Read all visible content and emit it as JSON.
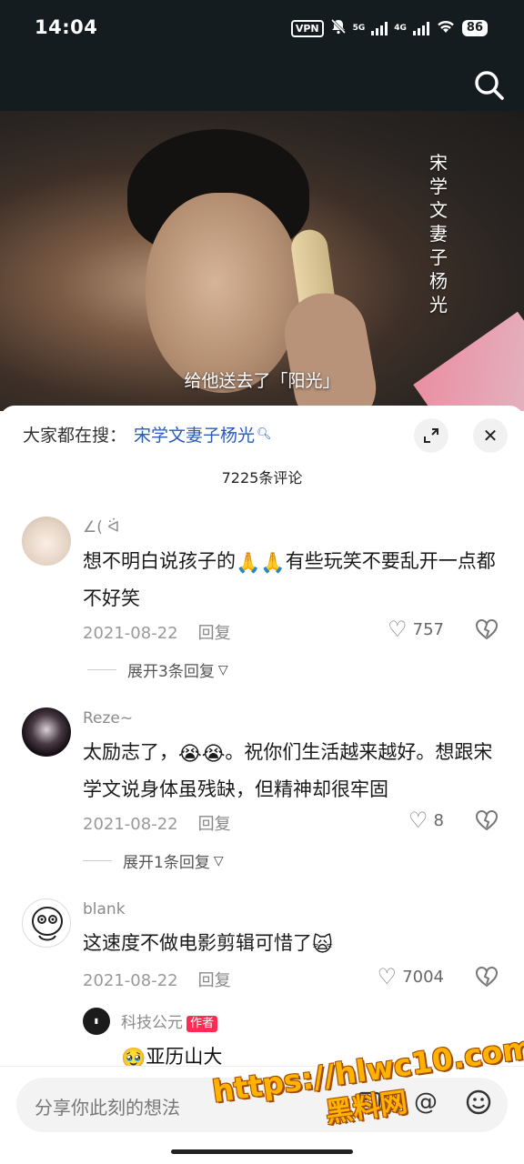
{
  "status_bar": {
    "time": "14:04",
    "vpn": "VPN",
    "net1": "5G",
    "net2": "4G",
    "battery": "86"
  },
  "video": {
    "vertical_title": "宋学文妻子杨光",
    "subtitle": "给他送去了「阳光」"
  },
  "comments_sheet": {
    "hot_search_label": "大家都在搜：",
    "hot_search_keyword": "宋学文妻子杨光",
    "comment_count": "7225条评论",
    "comments": [
      {
        "username": "∠( ᐛ",
        "text_before": "想不明白说孩子的",
        "emojis": "🙏🙏",
        "text_after": "有些玩笑不要乱开一点都不好笑",
        "date": "2021-08-22",
        "reply_label": "回复",
        "likes": "757",
        "more_replies": "展开3条回复"
      },
      {
        "username": "Reze~",
        "text_before": "太励志了，",
        "emojis": "😭😭",
        "text_after": "。祝你们生活越来越好。想跟宋学文说身体虽残缺，但精神却很牢固",
        "date": "2021-08-22",
        "reply_label": "回复",
        "likes": "8",
        "more_replies": "展开1条回复"
      },
      {
        "username": "blank",
        "text_before": "这速度不做电影剪辑可惜了",
        "emojis": "🙀",
        "text_after": "",
        "date": "2021-08-22",
        "reply_label": "回复",
        "likes": "7004",
        "sub_reply": {
          "username": "科技公元",
          "badge": "作者",
          "emoji": "🥹",
          "text": "亚历山大"
        }
      }
    ]
  },
  "input_bar": {
    "placeholder": "分享你此刻的想法"
  },
  "watermark": {
    "line1": "https://hlwc10.com",
    "line2": "黑料网"
  }
}
